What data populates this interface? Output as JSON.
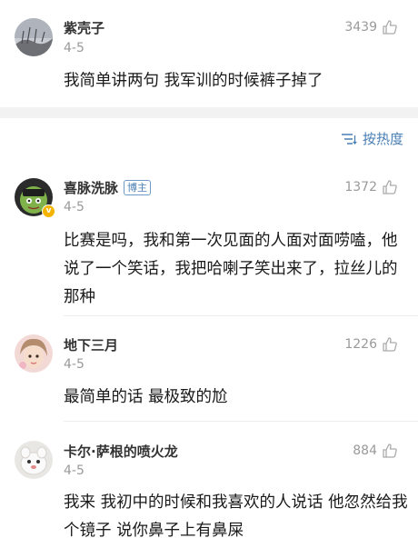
{
  "header_comment": {
    "username": "紫壳子",
    "date": "4-5",
    "likes": "3439",
    "text": "我简单讲两句 我军训的时候裤子掉了"
  },
  "sort": {
    "label": "按热度",
    "icon": "sort-icon"
  },
  "comments": [
    {
      "username": "喜脉洗脉",
      "badge": "博主",
      "verified_mark": "v",
      "date": "4-5",
      "likes": "1372",
      "text": "比赛是吗，我和第一次见面的人面对面唠嗑，他说了一个笑话，我把哈喇子笑出来了，拉丝儿的那种"
    },
    {
      "username": "地下三月",
      "date": "4-5",
      "likes": "1226",
      "text": "最简单的话 最极致的尬"
    },
    {
      "username": "卡尔·萨根的喷火龙",
      "date": "4-5",
      "likes": "884",
      "text": "我来 我初中的时候和我喜欢的人说话 他忽然给我个镜子 说你鼻子上有鼻屎"
    }
  ],
  "colors": {
    "link": "#4a7fb5",
    "meta": "#9a9a9a",
    "gap": "#f2f2f2"
  }
}
